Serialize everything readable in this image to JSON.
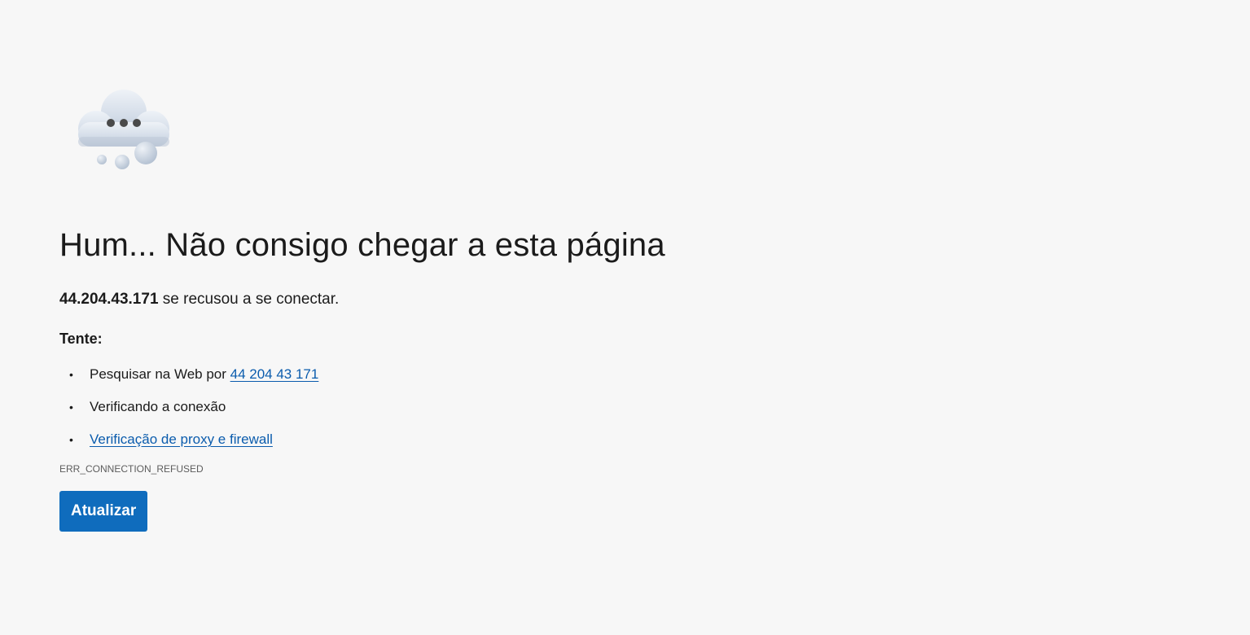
{
  "error": {
    "title": "Hum... Não consigo chegar a esta página",
    "host": "44.204.43.171",
    "message_suffix": " se recusou a se conectar.",
    "try_label": "Tente:",
    "suggestions": [
      {
        "prefix": "Pesquisar na Web por ",
        "link_text": "44 204 43 171"
      },
      {
        "text": "Verificando a conexão"
      },
      {
        "link_text": "Verificação de proxy e firewall"
      }
    ],
    "bullet": "•",
    "error_code": "ERR_CONNECTION_REFUSED",
    "reload_label": "Atualizar"
  },
  "icons": {
    "error_illustration": "cloud-thinking-icon"
  },
  "colors": {
    "background": "#f7f7f7",
    "link": "#0b5cad",
    "button": "#0f6cbd",
    "button_text": "#ffffff",
    "error_code": "#5d5d5d"
  }
}
